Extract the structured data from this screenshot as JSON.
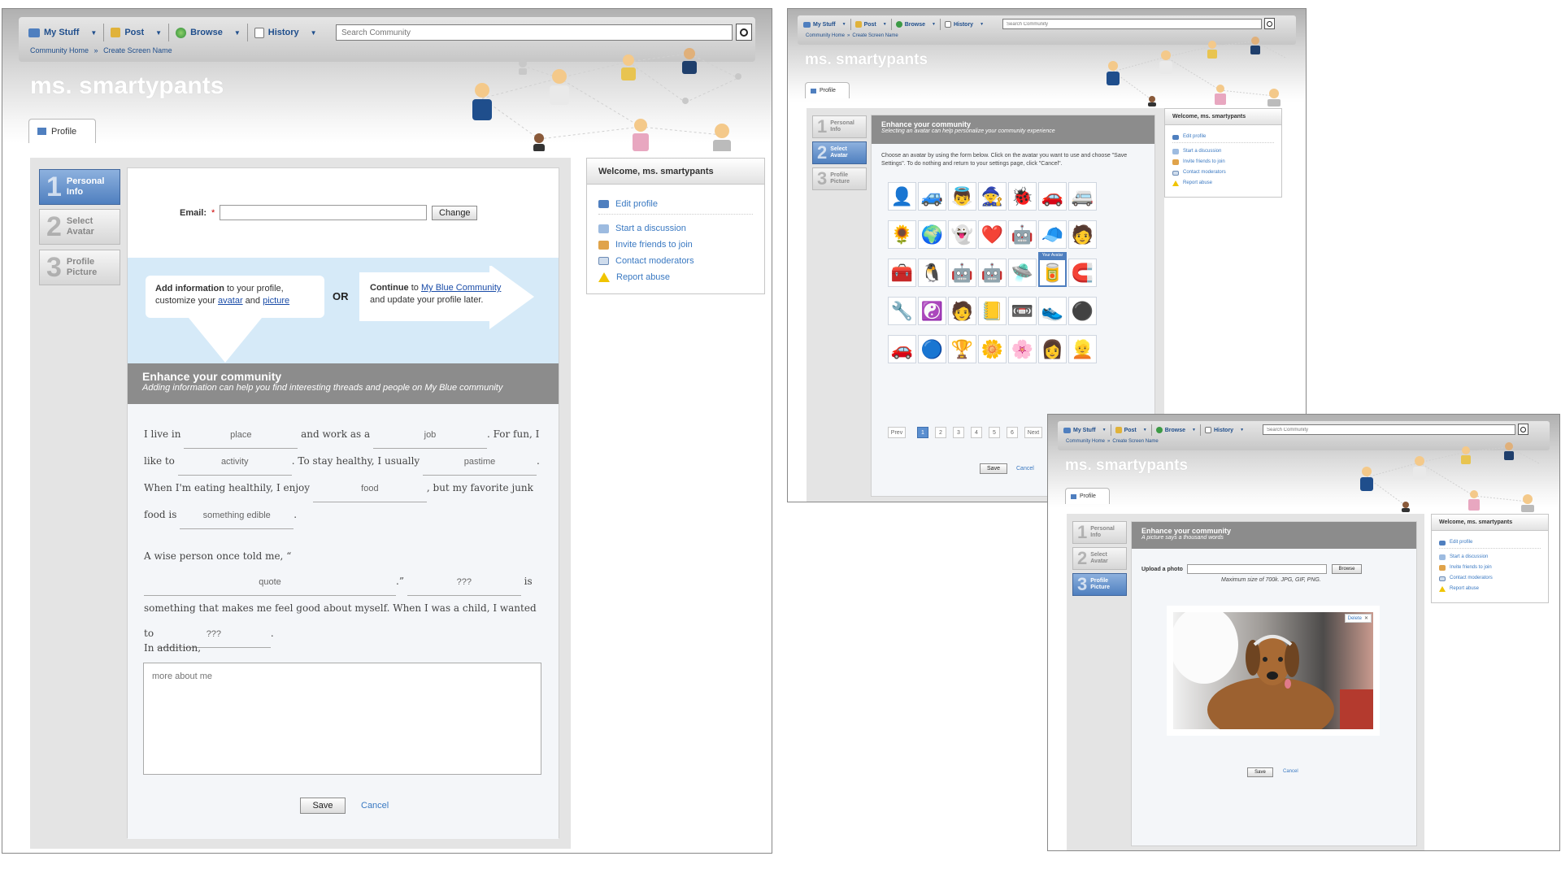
{
  "nav": {
    "my_stuff": "My Stuff",
    "post": "Post",
    "browse": "Browse",
    "history": "History",
    "search_placeholder": "Search Community",
    "breadcrumb_home": "Community Home",
    "breadcrumb_sep": "»",
    "breadcrumb_current": "Create Screen Name"
  },
  "profile": {
    "screen_name": "ms. smartypants",
    "tab_label": "Profile"
  },
  "steps": [
    {
      "num": "1",
      "line1": "Personal",
      "line2": "Info"
    },
    {
      "num": "2",
      "line1": "Select",
      "line2": "Avatar"
    },
    {
      "num": "3",
      "line1": "Profile",
      "line2": "Picture"
    }
  ],
  "email": {
    "label": "Email:",
    "required_mark": "*",
    "value": "",
    "change_label": "Change"
  },
  "cta": {
    "left_bold": "Add information",
    "left_rest": " to your profile,",
    "left_line2_pre": "customize your ",
    "left_link1": "avatar",
    "left_and": " and ",
    "left_link2": "picture",
    "or": "OR",
    "right_bold": "Continue",
    "right_to": " to ",
    "right_link": "My Blue Community",
    "right_line2": "and update your profile later."
  },
  "enhance": {
    "title": "Enhance your community",
    "subtitle_info": "Adding information can help you find interesting threads and people on My Blue community",
    "subtitle_avatar": "Selecting an avatar can help personalize your community experience",
    "subtitle_picture": "A picture says a thousand words"
  },
  "madlib": {
    "s1a": "I live in",
    "place": "place",
    "s1b": "and work as a",
    "job": "job",
    "s1c": ". For fun, I",
    "s2a": "like to",
    "activity": "activity",
    "s2b": ". To stay healthy, I usually",
    "pastime": "pastime",
    "s2c": ".",
    "s3a": "When I'm eating healthily, I enjoy",
    "food": "food",
    "s3b": ", but my favorite junk",
    "s4a": "food is",
    "edible": "something edible",
    "s4b": ".",
    "s5a": "A wise person once told me, “",
    "quote": "quote",
    "s5b": ".”",
    "q1": "???",
    "s6a": "is something that makes me feel good about myself.  When I",
    "s7a": "was a child, I wanted to",
    "q2": "???",
    "s7b": ".",
    "addition": "In addition,",
    "more_placeholder": "more about me"
  },
  "actions": {
    "save": "Save",
    "cancel": "Cancel"
  },
  "sidebar": {
    "welcome": "Welcome, ms. smartypants",
    "links": [
      "Edit profile",
      "Start a discussion",
      "Invite friends to join",
      "Contact moderators",
      "Report abuse"
    ]
  },
  "avatar_page": {
    "instructions": "Choose an avatar by using the form below. Click on the avatar you want to use and choose \"Save Settings\".  To do nothing and return to your settings page, click \"Cancel\".",
    "your_avatar_label": "Your Avatar",
    "avatars": [
      "👤",
      "🚙",
      "👼",
      "🧙",
      "🐞",
      "🚗",
      "🚐",
      "🌻",
      "🌍",
      "👻",
      "❤️",
      "🤖",
      "🧢",
      "🧑",
      "🧰",
      "🐧",
      "🤖",
      "🤖",
      "🛸",
      "🥫",
      "🧲",
      "🔧",
      "☯️",
      "🧑",
      "📒",
      "📼",
      "👟",
      "⚫",
      "🚗",
      "🔵",
      "🏆",
      "🌼",
      "🌸",
      "👩",
      "👱"
    ],
    "selected_index": 19,
    "prev": "Prev",
    "pages": [
      "1",
      "2",
      "3",
      "4",
      "5",
      "6"
    ],
    "current_page": "1",
    "next": "Next"
  },
  "picture_page": {
    "upload_label": "Upload a photo",
    "browse_label": "Browse",
    "max_size": "Maximum size of 700k. JPG, GIF, PNG.",
    "delete_label": "Delete"
  }
}
